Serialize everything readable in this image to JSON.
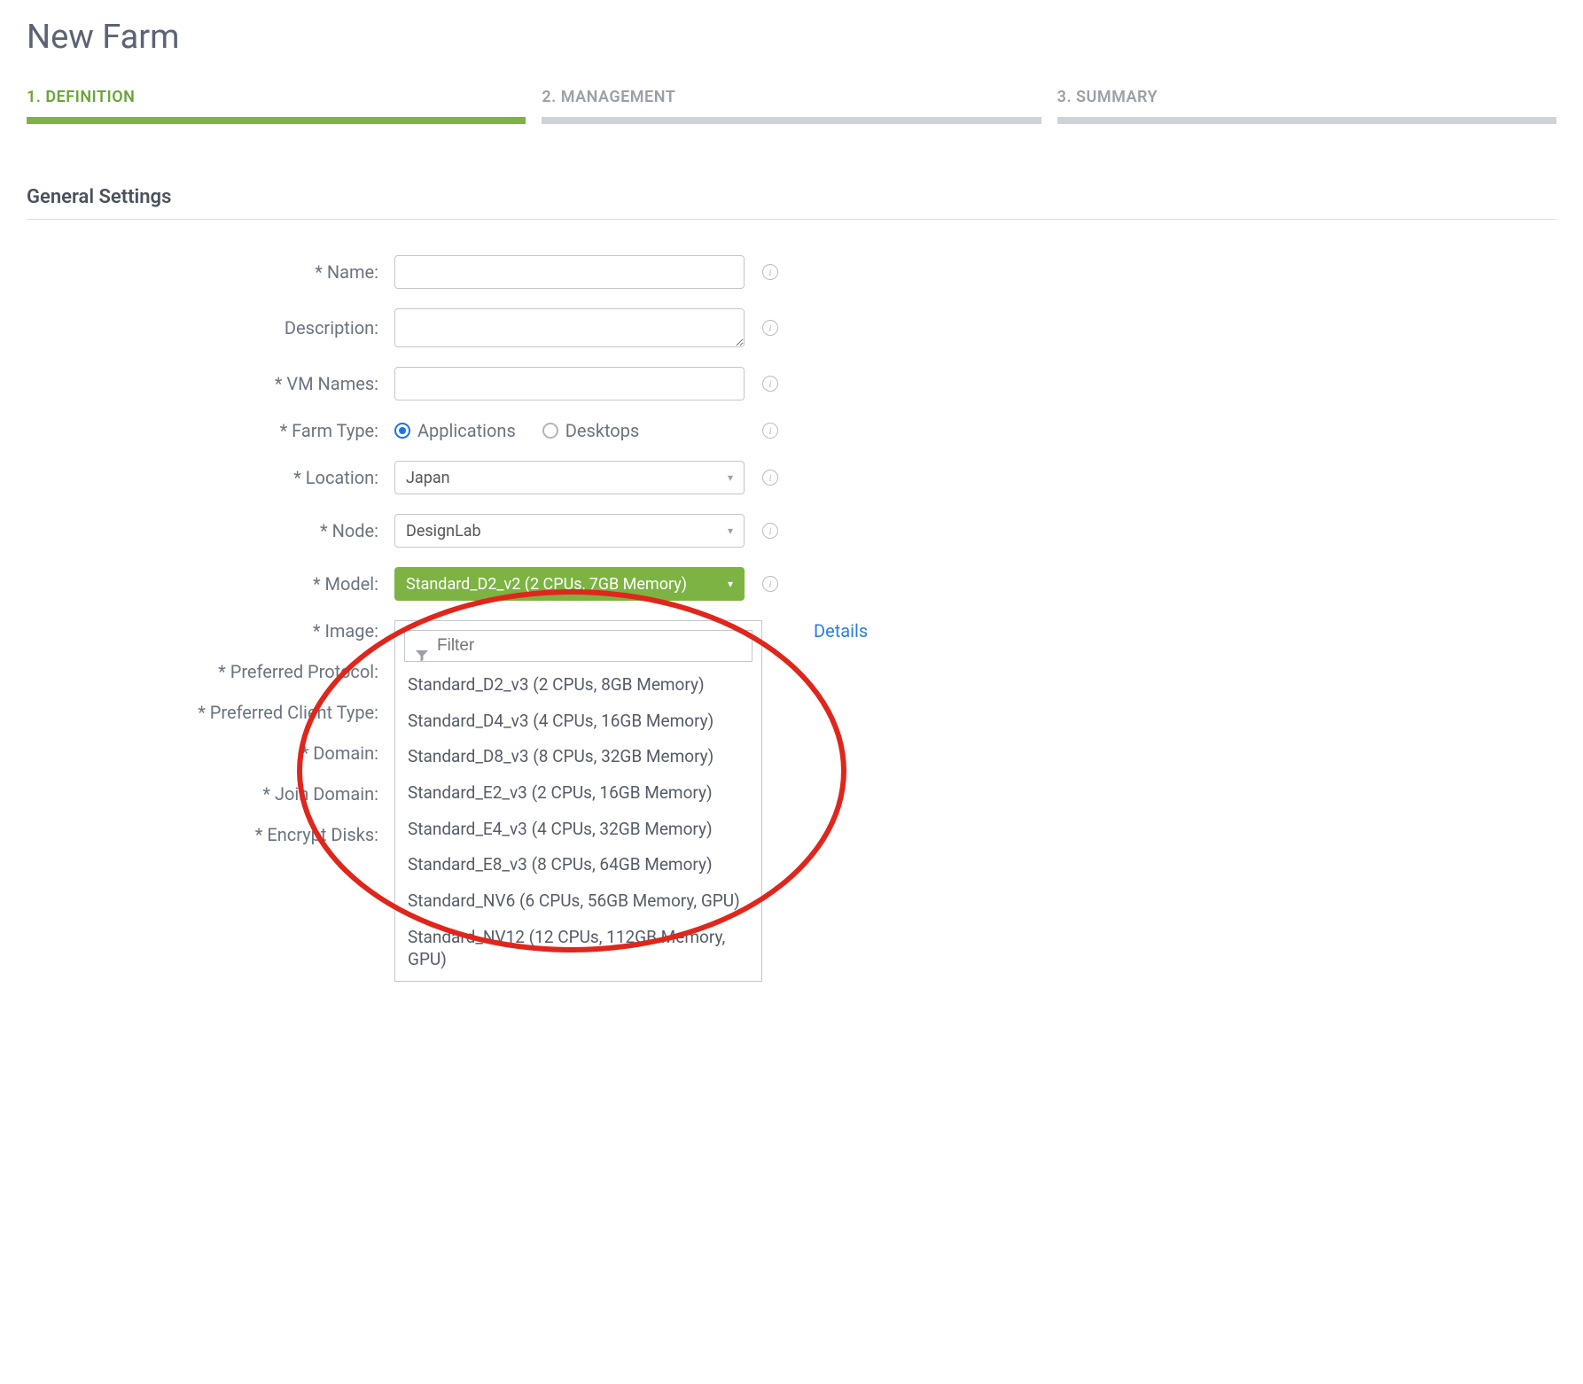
{
  "page": {
    "title": "New Farm"
  },
  "wizard": {
    "steps": [
      {
        "label": "1. DEFINITION",
        "active": true
      },
      {
        "label": "2. MANAGEMENT",
        "active": false
      },
      {
        "label": "3. SUMMARY",
        "active": false
      }
    ]
  },
  "section": {
    "general_title": "General Settings"
  },
  "fields": {
    "name_label": "* Name:",
    "name_value": "",
    "description_label": "Description:",
    "description_value": "",
    "vm_names_label": "* VM Names:",
    "vm_names_value": "",
    "farm_type_label": "* Farm Type:",
    "farm_type_options": {
      "applications": "Applications",
      "desktops": "Desktops"
    },
    "location_label": "* Location:",
    "location_value": "Japan",
    "node_label": "* Node:",
    "node_value": "DesignLab",
    "model_label": "* Model:",
    "model_value": "Standard_D2_v2 (2 CPUs, 7GB Memory)",
    "image_label": "* Image:",
    "preferred_protocol_label": "* Preferred Protocol:",
    "preferred_client_type_label": "* Preferred Client Type:",
    "domain_label": "* Domain:",
    "join_domain_label": "* Join Domain:",
    "encrypt_disks_label": "* Encrypt Disks:",
    "details_link": "Details"
  },
  "model_dropdown": {
    "filter_placeholder": "Filter",
    "options": [
      "Standard_D2_v3 (2 CPUs, 8GB Memory)",
      "Standard_D4_v3 (4 CPUs, 16GB Memory)",
      "Standard_D8_v3 (8 CPUs, 32GB Memory)",
      "Standard_E2_v3 (2 CPUs, 16GB Memory)",
      "Standard_E4_v3 (4 CPUs, 32GB Memory)",
      "Standard_E8_v3 (8 CPUs, 64GB Memory)",
      "Standard_NV6 (6 CPUs, 56GB Memory, GPU)",
      "Standard_NV12 (12 CPUs, 112GB Memory, GPU)"
    ]
  }
}
